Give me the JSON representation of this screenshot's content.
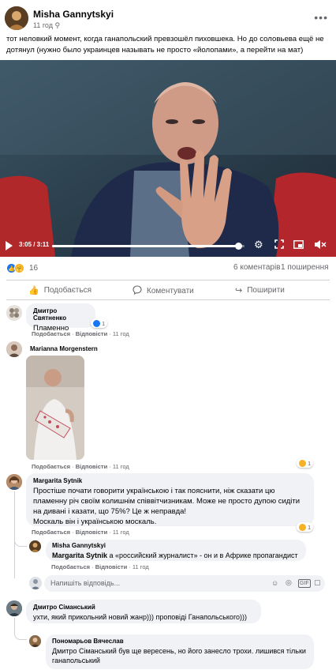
{
  "post": {
    "author": "Misha Gannytskyi",
    "time": "11 год",
    "text": "тот неловкий момент, когда ганапольский превзошёл пиховшека. Но до соловьева ещё не дотянул (нужно было украинцев называть не просто «йолопами», а перейти на мат)"
  },
  "video": {
    "time": "3:05 / 3:11",
    "progress": 0.97
  },
  "stats": {
    "reactions_count": "16",
    "comments": "6 коментарів",
    "shares": "1 поширення"
  },
  "actions": {
    "like": "Подобається",
    "comment": "Коментувати",
    "share": "Поширити"
  },
  "comment_meta": {
    "like": "Подобається",
    "reply": "Відповісти",
    "time": "11 год",
    "sep": "·"
  },
  "comments": [
    {
      "author": "Дмитро Святненко",
      "text": "Пламенно",
      "reactions": "1"
    },
    {
      "author": "Marianna Morgenstern",
      "reactions": "1"
    },
    {
      "author": "Margarita Sytnik",
      "text": "Простіше почати говорити українською і так пояснити, ніж сказати цю пламенну річ своїм колишнім співвітчизникам. Може не просто дупою сидіти на дивані і казати, що 75%? Це ж неправда!\nМоскаль він і українською москаль.",
      "reactions": "1"
    },
    {
      "author": "Misha Gannytskyi",
      "mention": "Margarita Sytnik",
      "text": " а «российский журналист» - он и в Африке пропагандист"
    },
    {
      "author": "Дмитро Сіманський",
      "text": "ухти, який прикольний новий жанр))) проповіді Ганапольського)))"
    },
    {
      "author": "Пономарьов Вячеслав",
      "text": "Дмитро Сіманський був ще вересень, но його занесло трохи. лишився тільки ганапольський"
    }
  ],
  "reply_input": {
    "placeholder": "Напишіть відповідь..."
  },
  "colors": {
    "link": "#050505",
    "meta": "#65676b",
    "bubble": "#f0f2f5",
    "like_blue": "#1877f2",
    "progress": "#1877f2"
  }
}
